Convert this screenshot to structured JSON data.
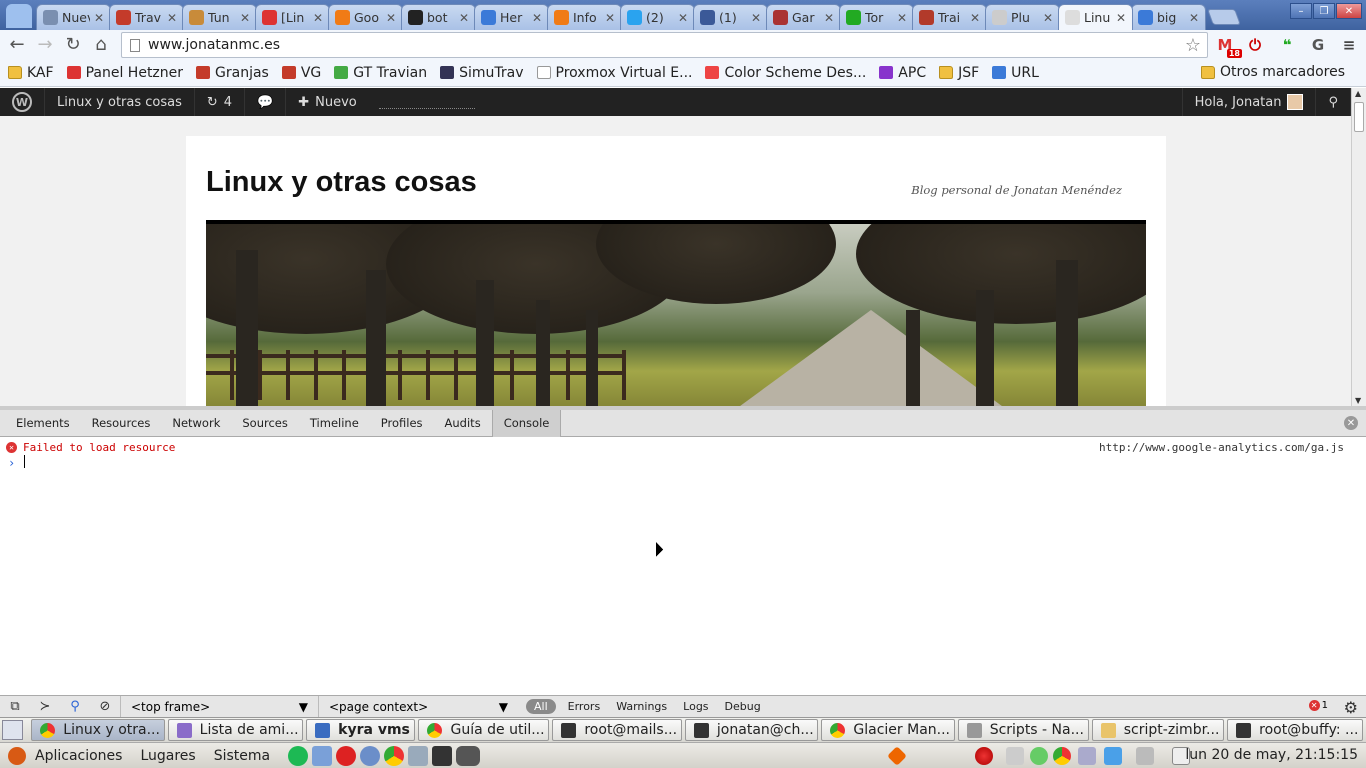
{
  "browser": {
    "tabs": [
      {
        "title": "Nueva",
        "icon": "new-tab-icon",
        "color": "#7a8fb0"
      },
      {
        "title": "Trav",
        "icon": "travian-icon",
        "color": "#c43b2a"
      },
      {
        "title": "Tun",
        "icon": "tunnel-icon",
        "color": "#c88b3a"
      },
      {
        "title": "[Lin",
        "icon": "gmail-icon",
        "color": "#d33"
      },
      {
        "title": "Goo",
        "icon": "analytics-icon",
        "color": "#f07b16"
      },
      {
        "title": "bot",
        "icon": "github-icon",
        "color": "#222"
      },
      {
        "title": "Her",
        "icon": "google-plus-icon",
        "color": "#3b7ad8"
      },
      {
        "title": "Info",
        "icon": "analytics-icon",
        "color": "#f07b16"
      },
      {
        "title": "(2)",
        "icon": "twitter-icon",
        "color": "#2aa3ef"
      },
      {
        "title": "(1)",
        "icon": "facebook-icon",
        "color": "#3b5998"
      },
      {
        "title": "Gar",
        "icon": "garmin-icon",
        "color": "#a33"
      },
      {
        "title": "Tor",
        "icon": "torrent-icon",
        "color": "#2a2"
      },
      {
        "title": "Trai",
        "icon": "travian-icon",
        "color": "#b23a2a"
      },
      {
        "title": "Plu",
        "icon": "page-icon",
        "color": "#ccc"
      },
      {
        "title": "Linu",
        "icon": "page-icon",
        "color": "#ddd",
        "active": true
      },
      {
        "title": "big",
        "icon": "google-icon",
        "color": "#3b7ad8"
      }
    ],
    "url": "www.jonatanmc.es",
    "gmail_badge": "18",
    "bookmarks": [
      {
        "label": "KAF",
        "icon": "folder-icon",
        "color": "#f0c040",
        "folder": true
      },
      {
        "label": "Panel Hetzner",
        "icon": "hetzner-icon",
        "color": "#d33"
      },
      {
        "label": "Granjas",
        "icon": "travian-icon",
        "color": "#c43b2a"
      },
      {
        "label": "VG",
        "icon": "travian-icon",
        "color": "#c43b2a"
      },
      {
        "label": "GT Travian",
        "icon": "gt-icon",
        "color": "#4a4"
      },
      {
        "label": "SimuTrav",
        "icon": "shield-icon",
        "color": "#335"
      },
      {
        "label": "Proxmox Virtual E...",
        "icon": "page-icon",
        "color": "#fff"
      },
      {
        "label": "Color Scheme Des...",
        "icon": "color-wheel-icon",
        "color": "#e44"
      },
      {
        "label": "APC",
        "icon": "flame-icon",
        "color": "#83c"
      },
      {
        "label": "JSF",
        "icon": "folder-icon",
        "color": "#f0c040",
        "folder": true
      },
      {
        "label": "URL",
        "icon": "google-icon",
        "color": "#3b7ad8"
      }
    ],
    "other_bookmarks": "Otros marcadores"
  },
  "wp_admin_bar": {
    "site_name": "Linux y otras cosas",
    "updates": "4",
    "new_label": "Nuevo",
    "greeting": "Hola, Jonatan"
  },
  "site": {
    "title": "Linux y otras cosas",
    "tagline": "Blog personal de Jonatan Menéndez"
  },
  "devtools": {
    "tabs": [
      "Elements",
      "Resources",
      "Network",
      "Sources",
      "Timeline",
      "Profiles",
      "Audits",
      "Console"
    ],
    "active_tab": "Console",
    "message": "Failed to load resource",
    "message_source": "http://www.google-analytics.com/ga.js",
    "frame_select": "<top frame>",
    "context_select": "<page context>",
    "filter_all": "All",
    "levels": [
      "Errors",
      "Warnings",
      "Logs",
      "Debug"
    ],
    "error_count": "1"
  },
  "taskbar": [
    {
      "label": "Linux y otra...",
      "icon": "chrome-icon",
      "active": true
    },
    {
      "label": "Lista de ami...",
      "icon": "pidgin-icon"
    },
    {
      "label": "kyra vms",
      "icon": "calendar-icon",
      "bold": true
    },
    {
      "label": "Guía de util...",
      "icon": "chrome-icon"
    },
    {
      "label": "root@mails...",
      "icon": "terminal-icon"
    },
    {
      "label": "jonatan@ch...",
      "icon": "terminal-icon"
    },
    {
      "label": "Glacier Man...",
      "icon": "chrome-icon"
    },
    {
      "label": "Scripts - Na...",
      "icon": "file-manager-icon"
    },
    {
      "label": "script-zimbr...",
      "icon": "editor-icon"
    },
    {
      "label": "root@buffy: ...",
      "icon": "terminal-icon"
    }
  ],
  "panel": {
    "menus": [
      "Aplicaciones",
      "Lugares",
      "Sistema"
    ],
    "clock": "lun 20 de may, 21:15:15"
  }
}
